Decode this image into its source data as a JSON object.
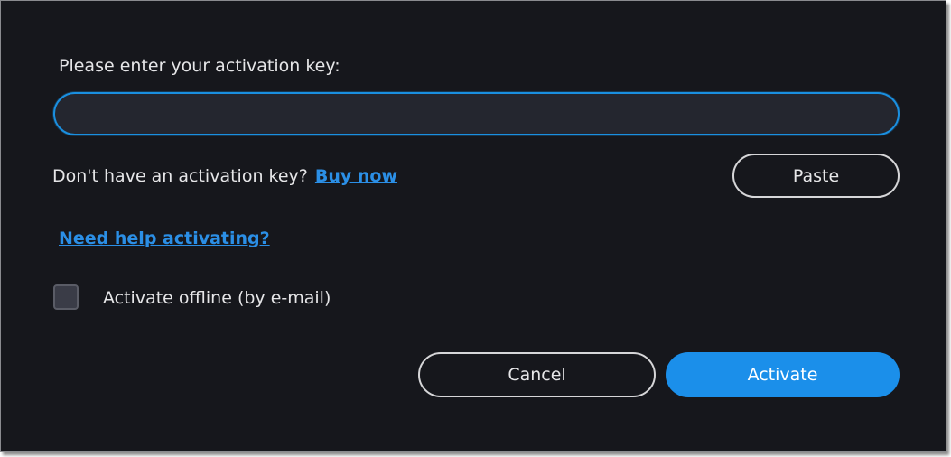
{
  "dialog": {
    "prompt": "Please enter your activation key:",
    "key_input": {
      "value": "",
      "placeholder": ""
    },
    "no_key_text": "Don't have an activation key?",
    "buy_now_label": "Buy now",
    "paste_label": "Paste",
    "help_link_label": "Need help activating?",
    "offline_checkbox": {
      "label": "Activate offline (by e-mail)",
      "checked": false
    },
    "cancel_label": "Cancel",
    "activate_label": "Activate"
  },
  "colors": {
    "background": "#16171c",
    "accent": "#1b8fea",
    "link": "#2b8fe6",
    "text": "#e6e6e8"
  }
}
